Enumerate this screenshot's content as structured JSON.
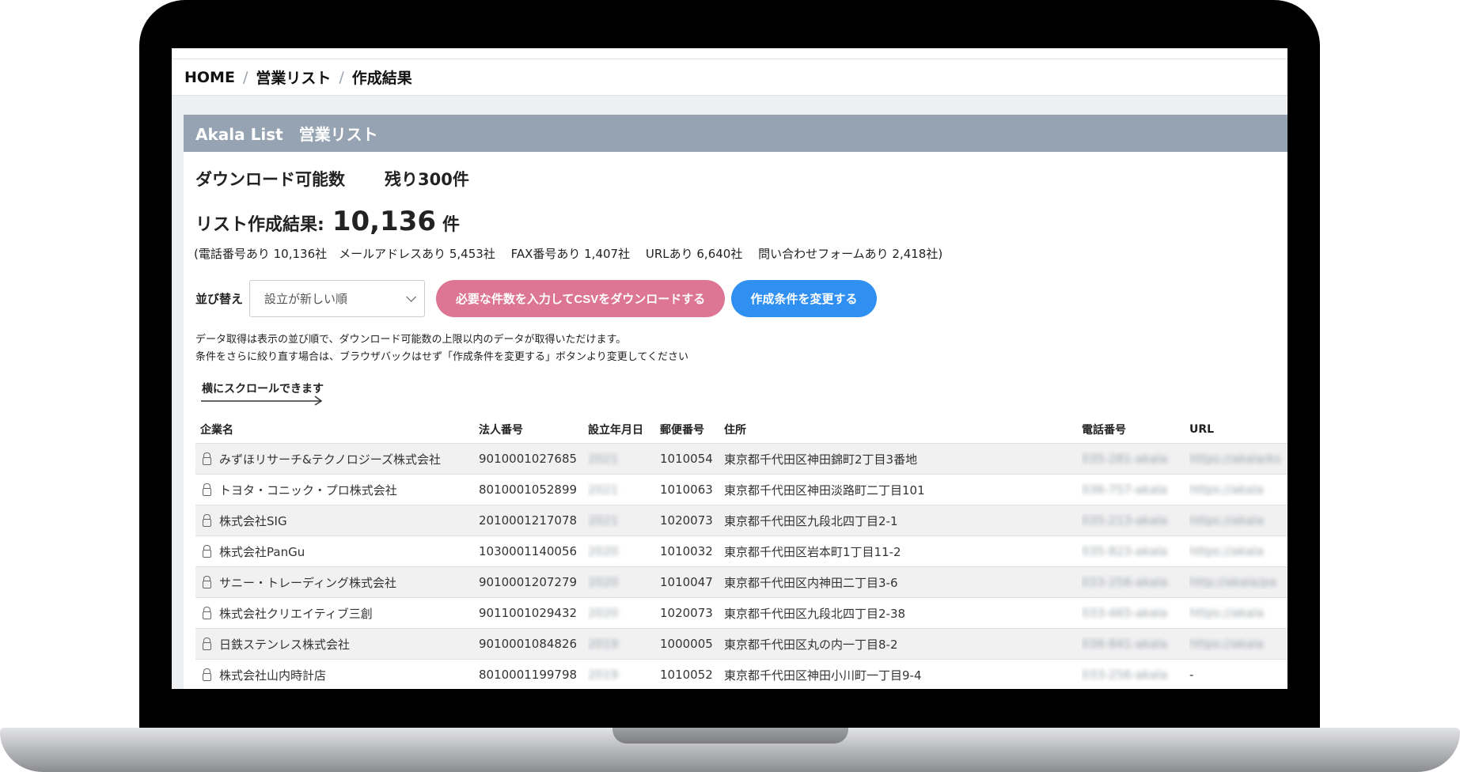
{
  "breadcrumb": [
    "HOME",
    "営業リスト",
    "作成結果"
  ],
  "panel": {
    "title": "Akala List　営業リスト"
  },
  "download": {
    "label": "ダウンロード可能数",
    "remaining": "残り300件"
  },
  "result": {
    "label": "リスト作成結果:",
    "count": "10,136",
    "unit": "件",
    "breakdown": "(電話番号あり 10,136社　メールアドレスあり 5,453社　 FAX番号あり 1,407社　 URLあり 6,640社　 問い合わせフォームあり 2,418社)"
  },
  "controls": {
    "sort_label": "並び替え",
    "sort_value": "設立が新しい順",
    "csv_button": "必要な件数を入力してCSVをダウンロードする",
    "change_button": "作成条件を変更する"
  },
  "notes": [
    "データ取得は表示の並び順で、ダウンロード可能数の上限以内のデータが取得いただけます。",
    "条件をさらに絞り直す場合は、ブラウザバックはせず「作成条件を変更する」ボタンより変更してください"
  ],
  "scroll_hint": "横にスクロールできます",
  "table": {
    "columns": [
      "企業名",
      "法人番号",
      "設立年月日",
      "郵便番号",
      "住所",
      "電話番号",
      "URL"
    ],
    "rows": [
      [
        "みずほリサーチ&テクノロジーズ株式会社",
        "9010001027685",
        "2021",
        "1010054",
        "東京都千代田区神田錦町2丁目3番地",
        "035-281-akala",
        "https://akala/ks"
      ],
      [
        "トヨタ・コニック・プロ株式会社",
        "8010001052899",
        "2021",
        "1010063",
        "東京都千代田区神田淡路町二丁目101",
        "036-757-akala",
        "https://akala"
      ],
      [
        "株式会社SIG",
        "2010001217078",
        "2021",
        "1020073",
        "東京都千代田区九段北四丁目2-1",
        "035-213-akala",
        "https://akala"
      ],
      [
        "株式会社PanGu",
        "1030001140056",
        "2020",
        "1010032",
        "東京都千代田区岩本町1丁目11-2",
        "035-823-akala",
        "https://akala"
      ],
      [
        "サニー・トレーディング株式会社",
        "9010001207279",
        "2020",
        "1010047",
        "東京都千代田区内神田二丁目3-6",
        "033-256-akala",
        "http://akala/pa"
      ],
      [
        "株式会社クリエイティブ三創",
        "9011001029432",
        "2020",
        "1020073",
        "東京都千代田区九段北四丁目2-38",
        "033-465-akala",
        "https://akala"
      ],
      [
        "日鉄ステンレス株式会社",
        "9010001084826",
        "2019",
        "1000005",
        "東京都千代田区丸の内一丁目8-2",
        "036-841-akala",
        "https://akala"
      ],
      [
        "株式会社山内時計店",
        "8010001199798",
        "2019",
        "1010052",
        "東京都千代田区神田小川町一丁目9-4",
        "033-256-akala",
        "-"
      ]
    ]
  }
}
